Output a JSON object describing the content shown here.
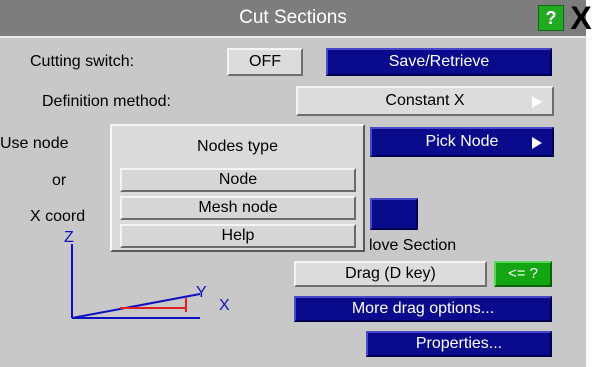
{
  "window": {
    "title": "Cut Sections",
    "help_label": "?",
    "close_label": "X"
  },
  "cutting_switch": {
    "label": "Cutting switch:",
    "toggle_label": "OFF",
    "save_retrieve_label": "Save/Retrieve"
  },
  "definition": {
    "label": "Definition method:",
    "value": "Constant X"
  },
  "node_row": {
    "label": "Use node",
    "pick_label": "Pick Node",
    "or_label": "or"
  },
  "coord_row": {
    "label": "X coord"
  },
  "popup": {
    "title": "Nodes type",
    "items": [
      "Node",
      "Mesh node",
      "Help"
    ]
  },
  "move_section_label": "love Section",
  "drag": {
    "label": "Drag (D key)",
    "help_label": "<= ?",
    "more_label": "More drag options..."
  },
  "properties_label": "Properties...",
  "axes": {
    "z": "Z",
    "y": "Y",
    "x": "X",
    "colors": {
      "z": "#1010c0",
      "y": "#1010c0",
      "x": "#e02020"
    }
  },
  "colors": {
    "panel": "#c8c8c8",
    "titlebar": "#7d7d7d",
    "blue_button": "#0a0a8c",
    "green_button": "#14a514"
  }
}
